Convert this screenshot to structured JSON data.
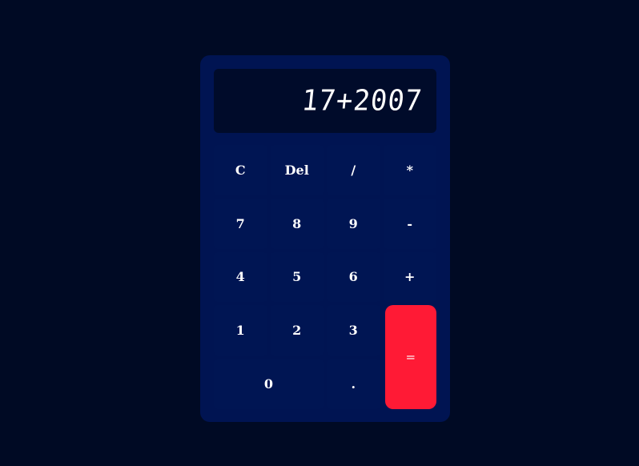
{
  "display": {
    "value": "17+2007"
  },
  "keys": {
    "clear": "C",
    "delete": "Del",
    "divide": "/",
    "multiply": "*",
    "seven": "7",
    "eight": "8",
    "nine": "9",
    "subtract": "-",
    "four": "4",
    "five": "5",
    "six": "6",
    "add": "+",
    "one": "1",
    "two": "2",
    "three": "3",
    "equals": "=",
    "zero": "0",
    "decimal": "."
  },
  "colors": {
    "background": "#000a24",
    "body": "#001452",
    "display": "#000b2a",
    "equals": "#ff1a35",
    "text": "#ffffff"
  }
}
